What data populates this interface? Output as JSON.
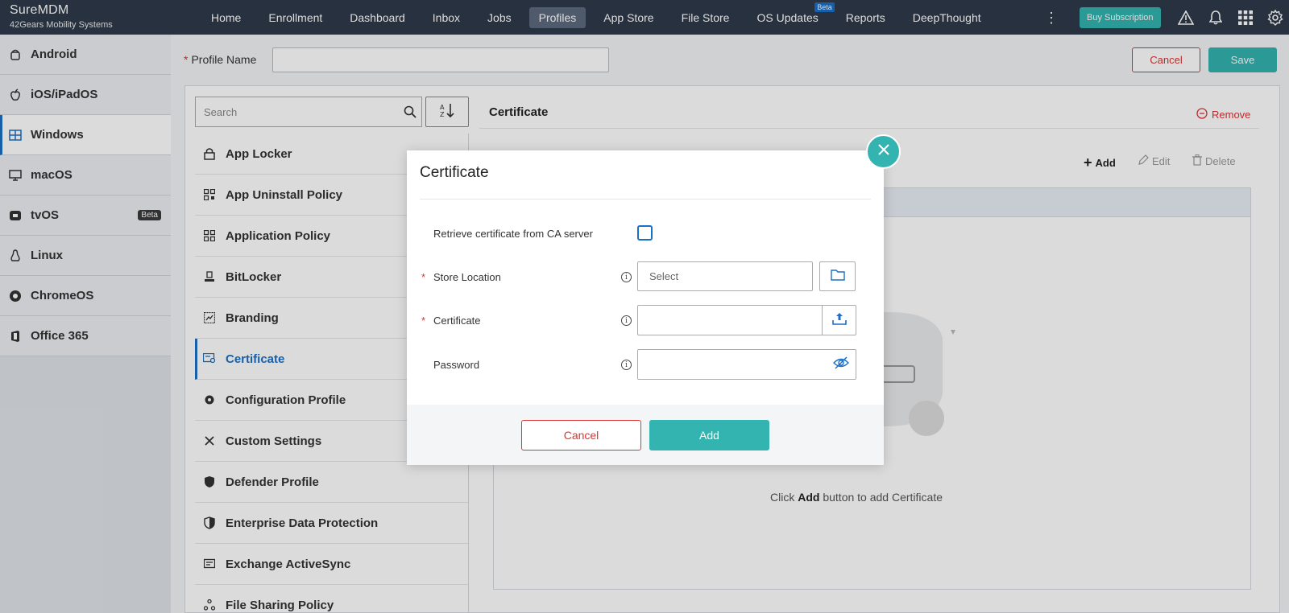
{
  "app": {
    "name": "SureMDM",
    "company": "42Gears Mobility Systems"
  },
  "topnav": {
    "items": [
      {
        "label": "Home"
      },
      {
        "label": "Enrollment"
      },
      {
        "label": "Dashboard"
      },
      {
        "label": "Inbox"
      },
      {
        "label": "Jobs"
      },
      {
        "label": "Profiles",
        "active": true
      },
      {
        "label": "App Store"
      },
      {
        "label": "File Store"
      },
      {
        "label": "OS Updates",
        "badge": "Beta"
      },
      {
        "label": "Reports"
      },
      {
        "label": "DeepThought"
      }
    ],
    "buy_subscription": "Buy Subscription",
    "icons": [
      "more-vertical-icon",
      "warning-icon",
      "bell-icon",
      "apps-grid-icon",
      "gear-icon"
    ]
  },
  "os_sidebar": {
    "items": [
      {
        "label": "Android",
        "icon": "android-icon"
      },
      {
        "label": "iOS/iPadOS",
        "icon": "apple-icon"
      },
      {
        "label": "Windows",
        "icon": "windows-icon",
        "active": true
      },
      {
        "label": "macOS",
        "icon": "monitor-icon"
      },
      {
        "label": "tvOS",
        "icon": "tv-icon",
        "badge": "Beta"
      },
      {
        "label": "Linux",
        "icon": "linux-icon"
      },
      {
        "label": "ChromeOS",
        "icon": "chrome-icon"
      },
      {
        "label": "Office 365",
        "icon": "office-icon"
      }
    ]
  },
  "profile": {
    "name_label": "Profile Name",
    "name_value": "",
    "cancel_label": "Cancel",
    "save_label": "Save"
  },
  "search": {
    "placeholder": "Search"
  },
  "policies": [
    {
      "label": "App Locker",
      "icon": "lock-icon"
    },
    {
      "label": "App Uninstall Policy",
      "icon": "qr-grid-icon"
    },
    {
      "label": "Application Policy",
      "icon": "app-grid-icon"
    },
    {
      "label": "BitLocker",
      "icon": "bitlocker-icon"
    },
    {
      "label": "Branding",
      "icon": "branding-icon"
    },
    {
      "label": "Certificate",
      "icon": "certificate-icon",
      "active": true
    },
    {
      "label": "Configuration Profile",
      "icon": "gear-icon"
    },
    {
      "label": "Custom Settings",
      "icon": "tools-icon"
    },
    {
      "label": "Defender Profile",
      "icon": "shield-icon"
    },
    {
      "label": "Enterprise Data Protection",
      "icon": "half-shield-icon"
    },
    {
      "label": "Exchange ActiveSync",
      "icon": "sync-icon"
    },
    {
      "label": "File Sharing Policy",
      "icon": "share-icon"
    }
  ],
  "cert_panel": {
    "title": "Certificate",
    "remove_label": "Remove",
    "toolbar": {
      "add": "Add",
      "edit": "Edit",
      "delete": "Delete"
    },
    "empty_prefix": "Click ",
    "empty_bold": "Add",
    "empty_suffix": " button to add Certificate"
  },
  "modal": {
    "title": "Certificate",
    "retrieve_label": "Retrieve certificate from CA server",
    "retrieve_checked": false,
    "store_location_label": "Store Location",
    "store_location_value": "Select",
    "certificate_label": "Certificate",
    "password_label": "Password",
    "cancel_label": "Cancel",
    "add_label": "Add"
  },
  "colors": {
    "nav_bg": "#2f3a4a",
    "accent_teal": "#33b4b0",
    "danger": "#dd3333",
    "active_blue": "#1b6fc4"
  }
}
